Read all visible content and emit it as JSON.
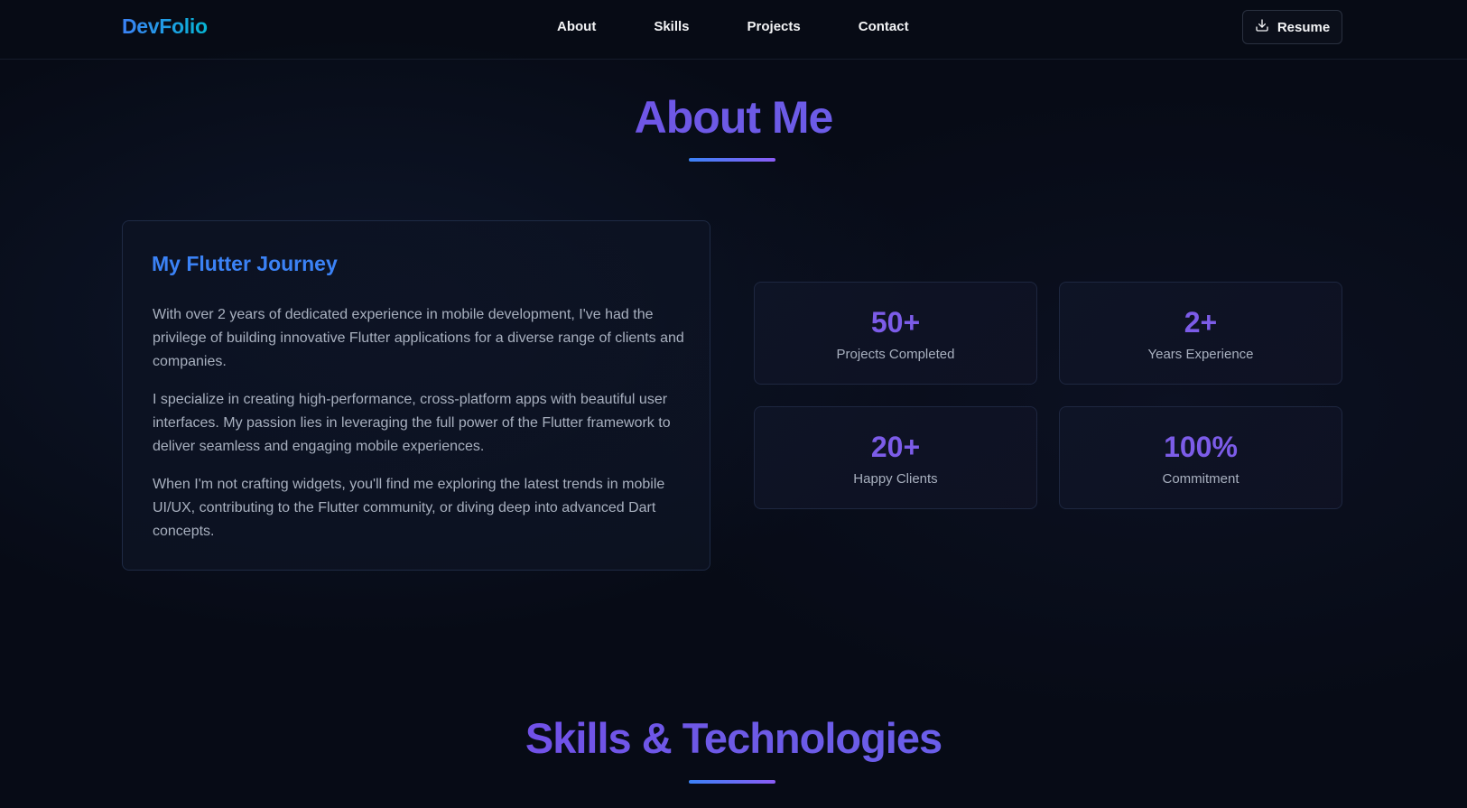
{
  "nav": {
    "brand": "DevFolio",
    "links": [
      "About",
      "Skills",
      "Projects",
      "Contact"
    ],
    "resume_label": "Resume",
    "resume_icon": "download-icon"
  },
  "about": {
    "title": "About Me",
    "journey": {
      "title": "My Flutter Journey",
      "paragraphs": [
        "With over 2 years of dedicated experience in mobile development, I've had the privilege of building innovative Flutter applications for a diverse range of clients and companies.",
        "I specialize in creating high-performance, cross-platform apps with beautiful user interfaces. My passion lies in leveraging the full power of the Flutter framework to deliver seamless and engaging mobile experiences.",
        "When I'm not crafting widgets, you'll find me exploring the latest trends in mobile UI/UX, contributing to the Flutter community, or diving deep into advanced Dart concepts."
      ]
    },
    "stats": [
      {
        "value": "50+",
        "label": "Projects Completed"
      },
      {
        "value": "2+",
        "label": "Years Experience"
      },
      {
        "value": "20+",
        "label": "Happy Clients"
      },
      {
        "value": "100%",
        "label": "Commitment"
      }
    ]
  },
  "skills": {
    "title": "Skills & Technologies"
  },
  "colors": {
    "background": "#070b16",
    "accent_blue": "#3b82f6",
    "accent_purple": "#7c5ce8",
    "text_muted": "#a8b0bf"
  }
}
